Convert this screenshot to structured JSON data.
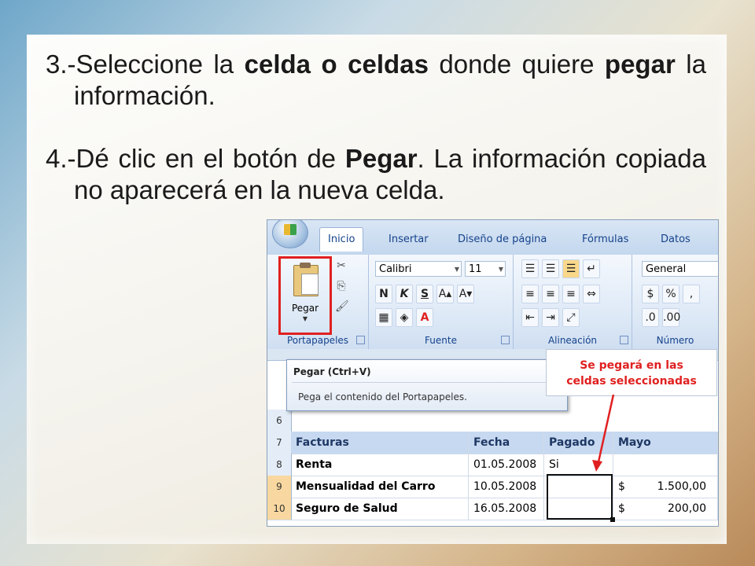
{
  "text": {
    "p3": {
      "a": "3.-Seleccione la ",
      "b": "celda o celdas",
      "c": " donde quiere ",
      "d": "pegar",
      "e": " la información."
    },
    "p4": {
      "a": "4.-Dé clic en el botón de ",
      "b": "Pegar",
      "c": ". La información copiada no aparecerá en la nueva celda."
    }
  },
  "ribbon": {
    "tabs": [
      "Inicio",
      "Insertar",
      "Diseño de página",
      "Fórmulas",
      "Datos"
    ],
    "groups": {
      "clipboard": "Portapapeles",
      "font": "Fuente",
      "alignment": "Alineación",
      "number": "Número"
    },
    "paste_label": "Pegar",
    "font_name": "Calibri",
    "font_size": "11",
    "number_format": "General",
    "font_buttons": [
      "N",
      "K",
      "S"
    ]
  },
  "tooltip": {
    "title": "Pegar (Ctrl+V)",
    "desc": "Pega el contenido del Portapapeles."
  },
  "callout": {
    "line1": "Se pegará en las",
    "line2": "celdas seleccionadas"
  },
  "sheet": {
    "rows": [
      {
        "n": "6",
        "cells": [
          "",
          "",
          "",
          ""
        ]
      },
      {
        "n": "7",
        "cells": [
          "Facturas",
          "Fecha",
          "Pagado",
          "Mayo"
        ]
      },
      {
        "n": "8",
        "cells": [
          "Renta",
          "01.05.2008",
          "Si",
          ""
        ]
      },
      {
        "n": "9",
        "cells": [
          "Mensualidad del Carro",
          "10.05.2008",
          "",
          "1.500,00"
        ]
      },
      {
        "n": "10",
        "cells": [
          "Seguro de Salud",
          "16.05.2008",
          "",
          "200,00"
        ]
      }
    ],
    "currency": "$"
  },
  "colors": {
    "accent_red": "#e02020",
    "header_fill": "#c6d9f0"
  }
}
